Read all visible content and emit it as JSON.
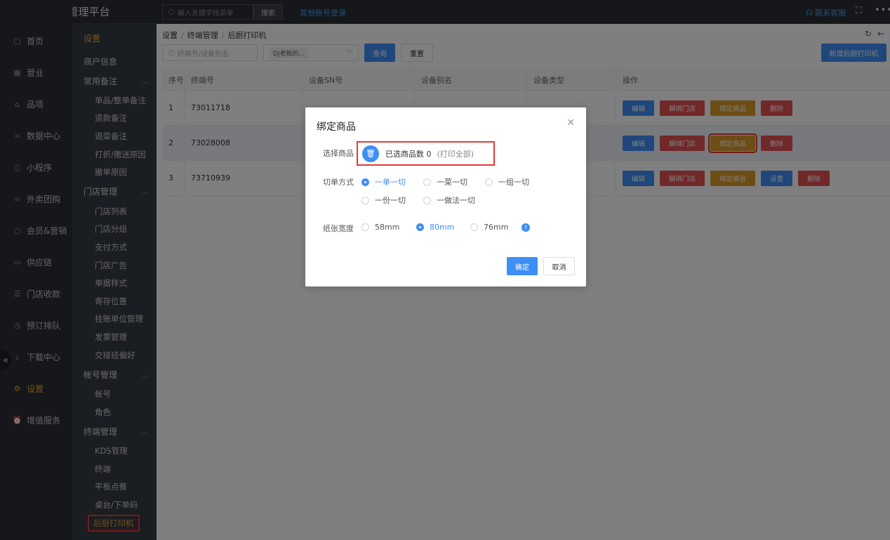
{
  "brand": "商户管理平台",
  "topbar": {
    "search_placeholder": "输入关键字找菜单",
    "search_label": "搜索",
    "other_login": "其他账号登录",
    "contact": "联系客服"
  },
  "nav1": [
    {
      "label": "首页",
      "icon": "home-icon"
    },
    {
      "label": "营业",
      "icon": "calendar-icon"
    },
    {
      "label": "品项",
      "icon": "bag-icon"
    },
    {
      "label": "数据中心",
      "icon": "share-icon"
    },
    {
      "label": "小程序",
      "icon": "phone-icon"
    },
    {
      "label": "外卖团购",
      "icon": "bike-icon"
    },
    {
      "label": "会员&营销",
      "icon": "user-icon"
    },
    {
      "label": "供应链",
      "icon": "truck-icon"
    },
    {
      "label": "门店收款",
      "icon": "database-icon"
    },
    {
      "label": "预订排队",
      "icon": "clock-icon"
    },
    {
      "label": "下载中心",
      "icon": "download-icon"
    },
    {
      "label": "设置",
      "icon": "gear-icon"
    },
    {
      "label": "增值服务",
      "icon": "alarm-icon"
    }
  ],
  "nav2": {
    "title": "设置",
    "merchant_info": "商户信息",
    "groups": [
      {
        "label": "常用备注",
        "items": [
          "单品/整单备注",
          "退款备注",
          "退菜备注",
          "打折/赠送原因",
          "撤单原因"
        ]
      },
      {
        "label": "门店管理",
        "items": [
          "门店列表",
          "门店分组",
          "支付方式",
          "门店广告",
          "单据样式",
          "寄存位置",
          "挂账单位管理",
          "发票管理",
          "交接班偏好"
        ]
      },
      {
        "label": "帐号管理",
        "items": [
          "帐号",
          "角色"
        ]
      },
      {
        "label": "终端管理",
        "items": [
          "KDS管理",
          "终端",
          "平板点餐",
          "桌台/下单码",
          "后厨打印机"
        ]
      }
    ]
  },
  "breadcrumb": [
    "设置",
    "终端管理",
    "后厨打印机"
  ],
  "filter": {
    "input_placeholder": "终端号/设备别名",
    "select_tag": "DJ老板的...",
    "query": "查询",
    "reset": "重置",
    "add": "新增后厨打印机"
  },
  "table": {
    "headers": [
      "序号",
      "终端号",
      "设备SN号",
      "设备别名",
      "设备类型",
      "操作"
    ],
    "rows": [
      {
        "no": "1",
        "terminal": "73011718",
        "sn": "",
        "alias": "",
        "type": "",
        "ops": [
          "编辑",
          "解绑门店",
          "绑定商品",
          "删除"
        ]
      },
      {
        "no": "2",
        "terminal": "73028008",
        "sn": "",
        "alias": "",
        "type": "",
        "ops": [
          "编辑",
          "解绑门店",
          "绑定商品",
          "删除"
        ]
      },
      {
        "no": "3",
        "terminal": "73710939",
        "sn": "",
        "alias": "",
        "type": "",
        "ops": [
          "编辑",
          "解绑门店",
          "绑定桌台",
          "设置",
          "删除"
        ]
      }
    ]
  },
  "modal": {
    "title": "绑定商品",
    "select_label": "选择商品",
    "selected_count": "已选商品数 0",
    "print_all": "(打印全部)",
    "cut_label": "切单方式",
    "cut_options": [
      "一单一切",
      "一菜一切",
      "一组一切",
      "一份一切",
      "一做法一切"
    ],
    "paper_label": "纸张宽度",
    "paper_options": [
      "58mm",
      "80mm",
      "76mm"
    ],
    "confirm": "确定",
    "cancel": "取消"
  },
  "colors": {
    "accent": "#3e8ef7",
    "active_nav": "#f0a32f",
    "danger": "#e35151",
    "warn": "#d99a2b"
  }
}
